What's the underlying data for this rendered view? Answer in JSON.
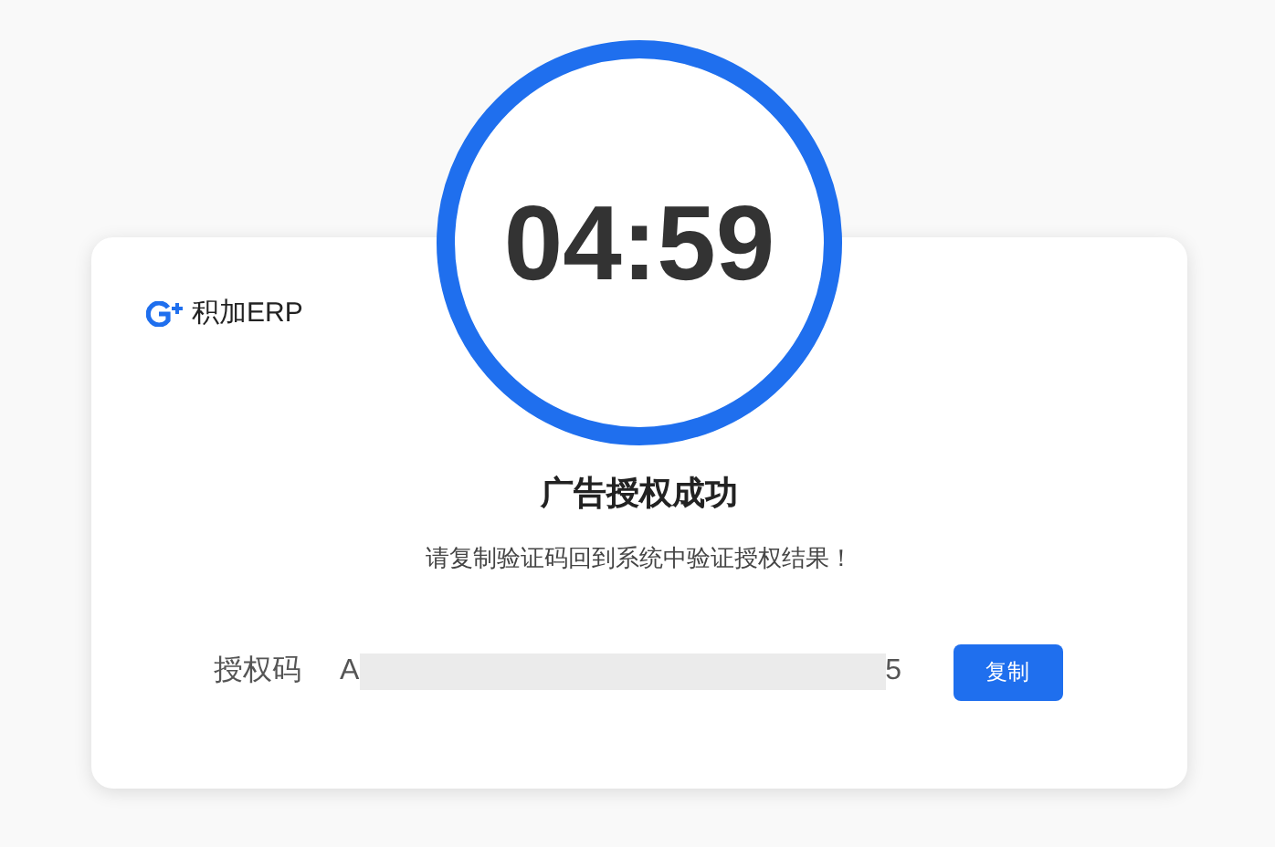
{
  "timer": {
    "countdown": "04:59"
  },
  "card": {
    "brand": "积加ERP",
    "title": "广告授权成功",
    "message": "请复制验证码回到系统中验证授权结果！",
    "code": {
      "label": "授权码",
      "visible_start": "A",
      "visible_end": "5"
    },
    "button": "复制"
  }
}
